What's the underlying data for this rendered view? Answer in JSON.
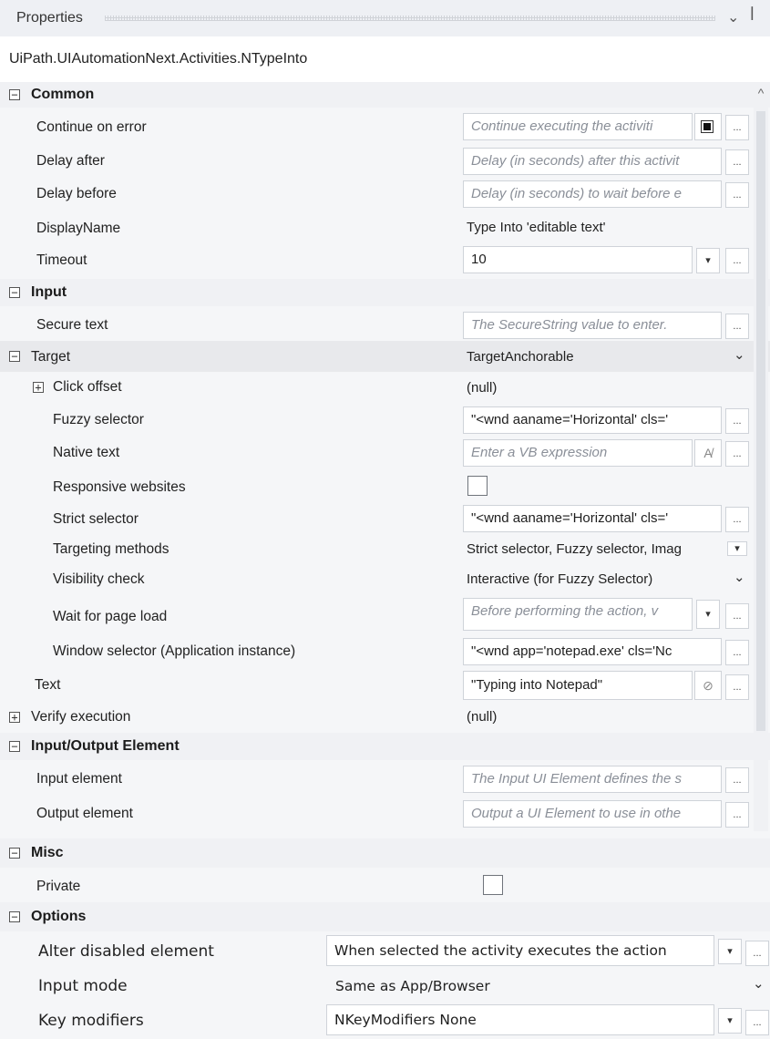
{
  "panel": {
    "title": "Properties",
    "dropdown_icon": "chevron-down",
    "pin_icon": "pin",
    "type_name": "UiPath.UIAutomationNext.Activities.NTypeInto"
  },
  "common": {
    "category": "Common",
    "continue_on_error": {
      "label": "Continue on error",
      "placeholder": "Continue executing the activiti"
    },
    "delay_after": {
      "label": "Delay after",
      "placeholder": "Delay (in seconds) after this activit"
    },
    "delay_before": {
      "label": "Delay before",
      "placeholder": "Delay (in seconds) to wait before e"
    },
    "display_name": {
      "label": "DisplayName",
      "value": "Type Into 'editable text'"
    },
    "timeout": {
      "label": "Timeout",
      "value": "10"
    }
  },
  "input": {
    "category": "Input",
    "secure_text": {
      "label": "Secure text",
      "placeholder": "The SecureString value to enter."
    },
    "target": {
      "label": "Target",
      "value": "TargetAnchorable"
    },
    "click_offset": {
      "label": "Click offset",
      "value": "(null)"
    },
    "fuzzy_selector": {
      "label": "Fuzzy selector",
      "value": "\"<wnd aaname='Horizontal' cls='"
    },
    "native_text": {
      "label": "Native text",
      "placeholder": "Enter a VB expression"
    },
    "responsive_websites": {
      "label": "Responsive websites"
    },
    "strict_selector": {
      "label": "Strict selector",
      "value": "\"<wnd aaname='Horizontal' cls='"
    },
    "targeting_methods": {
      "label": "Targeting methods",
      "value": "Strict selector, Fuzzy selector, Imag"
    },
    "visibility_check": {
      "label": "Visibility check",
      "value": "Interactive (for Fuzzy Selector)"
    },
    "wait_for_page_load": {
      "label": "Wait for page load",
      "placeholder": "Before performing the action, v"
    },
    "window_selector": {
      "label": "Window selector (Application instance)",
      "value": "\"<wnd app='notepad.exe' cls='Nc"
    },
    "text": {
      "label": "Text",
      "value": "\"Typing into Notepad\""
    },
    "verify_execution": {
      "label": "Verify execution",
      "value": "(null)"
    }
  },
  "io_element": {
    "category": "Input/Output Element",
    "input_element": {
      "label": "Input element",
      "placeholder": "The Input UI Element defines the s"
    },
    "output_element": {
      "label": "Output element",
      "placeholder": "Output a UI Element to use in othe"
    }
  },
  "misc": {
    "category": "Misc",
    "private": {
      "label": "Private"
    }
  },
  "options": {
    "category": "Options",
    "alter_disabled": {
      "label": "Alter disabled element",
      "value": "When selected the activity executes the action"
    },
    "input_mode": {
      "label": "Input mode",
      "value": "Same as App/Browser"
    },
    "key_modifiers": {
      "label": "Key modifiers",
      "value": "NKeyModifiers None"
    }
  },
  "glyphs": {
    "ellipsis": "...",
    "collapse": "−",
    "expand": "+",
    "chevron": "⌄",
    "dropdown": "▾",
    "up": "^",
    "pin": "ᵖ"
  }
}
